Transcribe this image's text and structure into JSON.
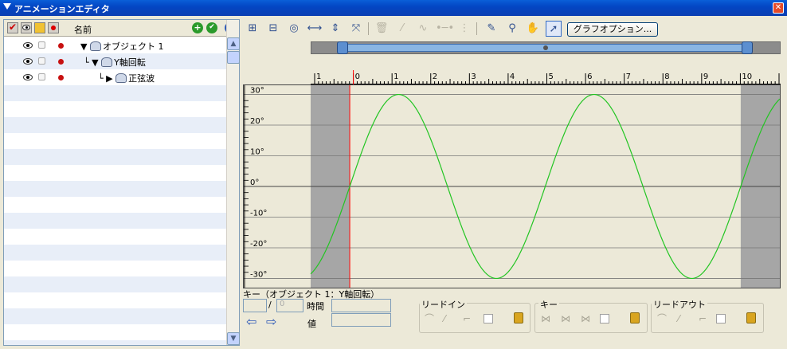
{
  "window": {
    "title": "アニメーションエディタ",
    "close_glyph": "✕"
  },
  "layers": {
    "header": {
      "name": "名前",
      "add": "+",
      "down": "✔",
      "collapse": "«"
    },
    "rows": [
      {
        "expander": "▼",
        "label": "オブジェクト 1"
      },
      {
        "expander": "▼",
        "label": "Y軸回転"
      },
      {
        "expander": "▶",
        "label": "正弦波"
      }
    ]
  },
  "toolbar": {
    "icons": [
      "key-add-icon",
      "key-delete-icon",
      "view-icon",
      "fit-horizontal-icon",
      "fit-vertical-icon",
      "fit-all-icon",
      "trash-icon",
      "key-link-icon",
      "key-curve-icon",
      "key-linear-icon",
      "key-step-icon",
      "pen-icon",
      "zoom-icon",
      "hand-icon",
      "pointer-icon"
    ],
    "graph_options": "グラフオプション..."
  },
  "ruler": {
    "labels": [
      "1",
      "0",
      "1",
      "2",
      "3",
      "4",
      "5",
      "6",
      "7",
      "8",
      "9",
      "10",
      "1"
    ]
  },
  "chart_data": {
    "type": "line",
    "yticks": [
      "30°",
      "20°",
      "10°",
      "0°",
      "-10°",
      "-20°",
      "-30°"
    ],
    "ylim": [
      -33,
      33
    ],
    "xlim": [
      -1,
      11
    ],
    "active_range": [
      0,
      10
    ],
    "series": [
      {
        "color": "#22c522",
        "amplitude": 30,
        "period": 5,
        "phase_peak_x": 1.25
      }
    ]
  },
  "keypanel": {
    "title": "キー（オブジェクト 1：Y軸回転）",
    "slash": "/",
    "frame_placeholder": "0",
    "time_label": "時間",
    "value_label": "値",
    "lead_in": "リードイン",
    "key": "キー",
    "lead_out": "リードアウト"
  },
  "colors": {
    "title_bar": "#0a5fd8",
    "curve": "#22c522",
    "inactive": "#a6a6a6",
    "cursor": "#ff0000"
  }
}
